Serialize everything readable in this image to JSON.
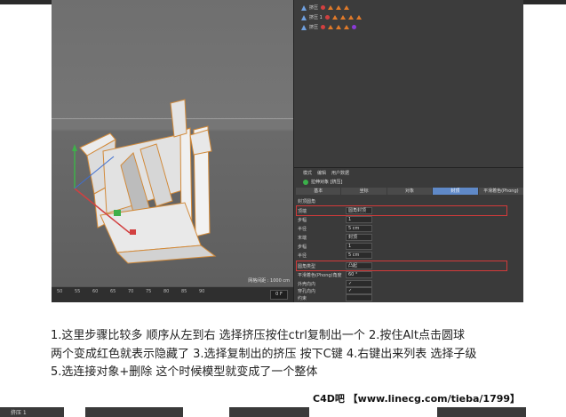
{
  "viewport": {
    "hud": "网格间距 : 1000 cm"
  },
  "timeline": {
    "ticks": [
      "50",
      "55",
      "60",
      "65",
      "70",
      "75",
      "80",
      "85",
      "90"
    ],
    "frame_value": "0 F"
  },
  "object_manager": {
    "rows": [
      {
        "label": "挤压"
      },
      {
        "label": "挤压 1"
      },
      {
        "label": "挤压"
      }
    ]
  },
  "attributes": {
    "menu": [
      "模式",
      "编辑",
      "用户数据"
    ],
    "title": "拉伸对象 [挤压]",
    "tabs": [
      "基本",
      "坐标",
      "对象",
      "封顶",
      "平滑着色(Phong)"
    ],
    "active_tab": "封顶",
    "section": "封顶圆角",
    "rows": [
      {
        "label": "顶端",
        "value": "圆角封顶"
      },
      {
        "label": "步幅",
        "value": "1"
      },
      {
        "label": "半径",
        "value": "5 cm"
      },
      {
        "label": "末端",
        "value": "封顶"
      },
      {
        "label": "步幅",
        "value": "1"
      },
      {
        "label": "半径",
        "value": "5 cm"
      },
      {
        "label": "圆角类型",
        "value": "凸起"
      },
      {
        "label": "平滑着色(Phong)角度",
        "value": "60 °"
      },
      {
        "label": "外壳向内",
        "value": "✓"
      },
      {
        "label": "穿孔向内",
        "value": "✓"
      },
      {
        "label": "约束",
        "value": ""
      }
    ]
  },
  "caption": {
    "line1": "1.这里步骤比较多 顺序从左到右 选择挤压按住ctrl复制出一个 2.按住Alt点击圆球",
    "line2": "两个变成红色就表示隐藏了 3.选择复制出的挤压 按下C键  4.右键出来列表 选择子级",
    "line3": "5.选连接对象+删除 这个时候模型就变成了一个整体"
  },
  "watermark": "C4D吧 【www.linecg.com/tieba/1799】",
  "bottom_strip": {
    "label": "挤压 1"
  },
  "colors": {
    "accent_tab": "#5f89c8",
    "highlight_box": "#d33a3a",
    "caption_text": "#222222"
  }
}
